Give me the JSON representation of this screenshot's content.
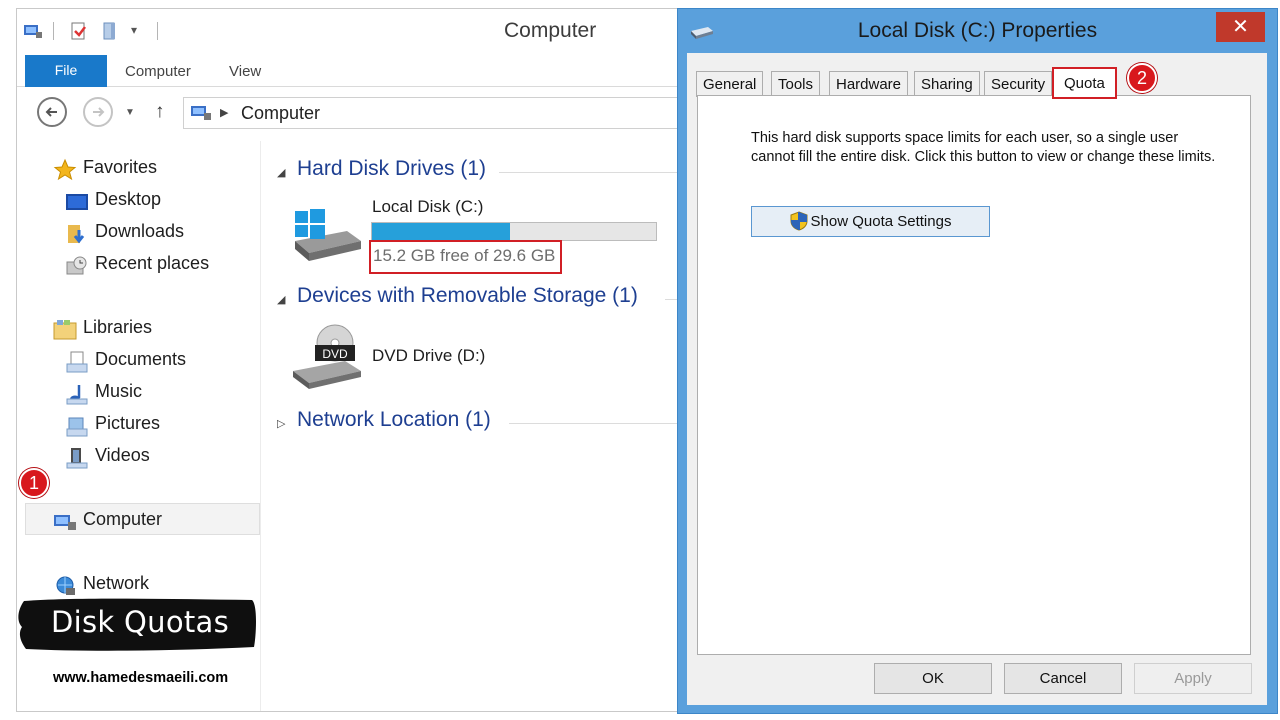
{
  "explorer": {
    "title": "Computer",
    "ribbon": {
      "file_tab": "File",
      "tabs": [
        "Computer",
        "View"
      ]
    },
    "address": {
      "path": "Computer"
    },
    "nav": {
      "favorites": "Favorites",
      "desktop": "Desktop",
      "downloads": "Downloads",
      "recent": "Recent places",
      "libraries": "Libraries",
      "documents": "Documents",
      "music": "Music",
      "pictures": "Pictures",
      "videos": "Videos",
      "computer": "Computer",
      "network": "Network"
    },
    "groups": {
      "hard_disk": "Hard Disk Drives (1)",
      "removable": "Devices with Removable Storage (1)",
      "network": "Network Location (1)"
    },
    "local_disk": {
      "label": "Local Disk (C:)",
      "free_text": "15.2 GB free of 29.6 GB",
      "used_fraction": 0.486
    },
    "dvd": {
      "label": "DVD Drive (D:)",
      "icon_text": "DVD"
    }
  },
  "dialog": {
    "title": "Local Disk (C:) Properties",
    "close_label": "✕",
    "tabs": [
      "General",
      "Tools",
      "Hardware",
      "Sharing",
      "Security",
      "Quota"
    ],
    "active_tab": "Quota",
    "description": "This hard disk supports space limits for each user, so a single user cannot fill the entire disk. Click this button to view or change these limits.",
    "quota_button": "Show Quota Settings",
    "buttons": {
      "ok": "OK",
      "cancel": "Cancel",
      "apply": "Apply"
    }
  },
  "overlay": {
    "step1": "1",
    "step2": "2",
    "caption": "Disk Quotas",
    "website": "www.hamedesmaeili.com"
  },
  "colors": {
    "accent": "#1979ca",
    "highlight_red": "#d11f25",
    "dialog_frame": "#5aa0dc",
    "capacity_fill": "#26a0da"
  }
}
